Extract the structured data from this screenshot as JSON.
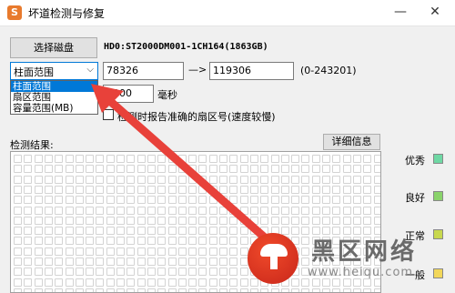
{
  "window": {
    "title": "坏道检测与修复",
    "minimize_icon": "—",
    "close_icon": "✕"
  },
  "toolbar": {
    "select_disk_label": "选择磁盘",
    "disk_info": "HD0:ST2000DM001-1CH164(1863GB)"
  },
  "range": {
    "selected": "柱面范围",
    "options": [
      "柱面范围",
      "扇区范围",
      "容量范围(MB)"
    ],
    "start_value": "78326",
    "arrow": "—>",
    "end_value": "119306",
    "hint": "(0-243201)"
  },
  "timeout": {
    "value": "3000",
    "unit_label": "毫秒"
  },
  "report_option": {
    "label": "检测时报告准确的扇区号(速度较慢)",
    "checked": false
  },
  "results": {
    "label": "检测结果:",
    "detail_button": "详细信息"
  },
  "legend": [
    {
      "label": "优秀",
      "color": "#6fd8a4"
    },
    {
      "label": "良好",
      "color": "#8ad36b"
    },
    {
      "label": "正常",
      "color": "#c8d84e"
    },
    {
      "label": "一般",
      "color": "#f2d75a"
    }
  ],
  "watermark": {
    "logo_text": "黑区网络",
    "url": "www.heiqu.com"
  },
  "colors": {
    "accent": "#0078d7",
    "annotation_arrow": "#e8413a"
  }
}
